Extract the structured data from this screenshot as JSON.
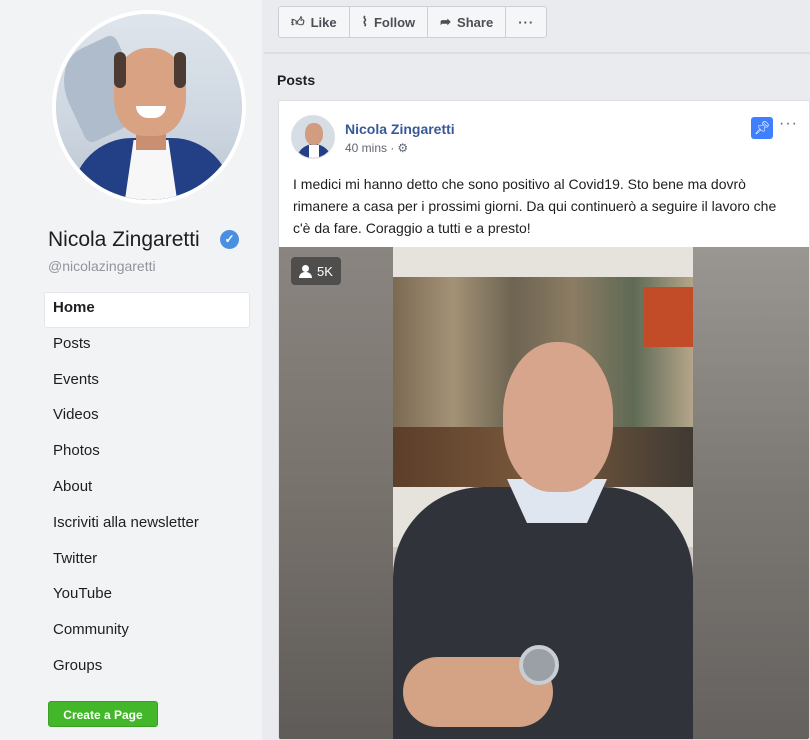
{
  "profile": {
    "name": "Nicola Zingaretti",
    "handle": "@nicolazingaretti",
    "verified": true
  },
  "sidebar": {
    "items": [
      {
        "label": "Home",
        "active": true
      },
      {
        "label": "Posts"
      },
      {
        "label": "Events"
      },
      {
        "label": "Videos"
      },
      {
        "label": "Photos"
      },
      {
        "label": "About"
      },
      {
        "label": "Iscriviti alla newsletter"
      },
      {
        "label": "Twitter"
      },
      {
        "label": "YouTube"
      },
      {
        "label": "Community"
      },
      {
        "label": "Groups"
      }
    ],
    "create_page_label": "Create a Page"
  },
  "actions": {
    "like": "Like",
    "follow": "Follow",
    "share": "Share",
    "more": "···"
  },
  "main": {
    "section_title": "Posts"
  },
  "post": {
    "author": "Nicola Zingaretti",
    "time": "40 mins ·",
    "more": "···",
    "text": "I medici mi hanno detto che sono positivo al Covid19. Sto bene ma dovrò rimanere a casa per i prossimi giorni. Da qui continuerò a seguire il lavoro che c'è da fare. Coraggio a tutti e a presto!",
    "viewers": "5K"
  },
  "colors": {
    "link_blue": "#385898",
    "create_green": "#42b72a",
    "verified_blue": "#4a90e2",
    "pin_blue": "#4080ff"
  },
  "icons": [
    "like-icon",
    "follow-icon",
    "share-icon",
    "gear-icon",
    "pin-icon",
    "verified-icon",
    "viewer-icon"
  ]
}
